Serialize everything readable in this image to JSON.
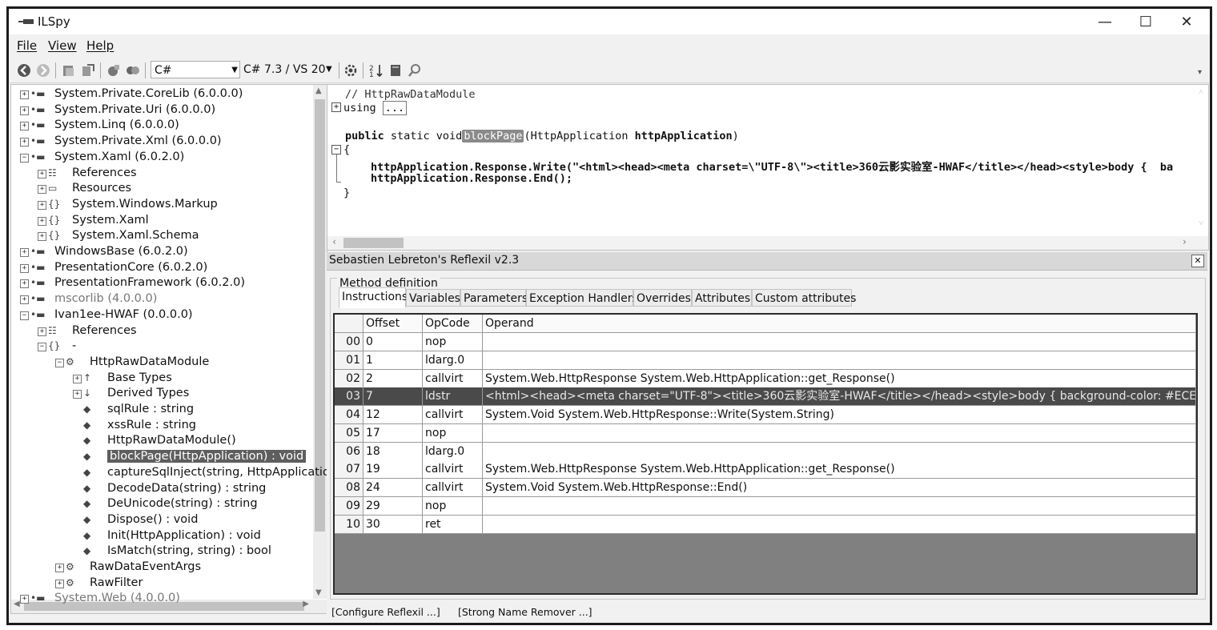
{
  "window": {
    "title": "ILSpy"
  },
  "menu": [
    "File",
    "View",
    "Help"
  ],
  "toolbar": {
    "language": "C#",
    "version": "C# 7.3 / VS 20"
  },
  "tree": {
    "nodes": [
      {
        "label": "System.Private.CoreLib (6.0.0.0)",
        "exp": "+"
      },
      {
        "label": "System.Private.Uri (6.0.0.0)",
        "exp": "+"
      },
      {
        "label": "System.Linq (6.0.0.0)",
        "exp": "+"
      },
      {
        "label": "System.Private.Xml (6.0.0.0)",
        "exp": "+"
      },
      {
        "label": "System.Xaml (6.0.2.0)",
        "exp": "-"
      },
      {
        "label": "References",
        "exp": "+"
      },
      {
        "label": "Resources",
        "exp": "+"
      },
      {
        "label": "System.Windows.Markup",
        "exp": "+"
      },
      {
        "label": "System.Xaml",
        "exp": "+"
      },
      {
        "label": "System.Xaml.Schema",
        "exp": "+"
      },
      {
        "label": "WindowsBase (6.0.2.0)",
        "exp": "+"
      },
      {
        "label": "PresentationCore (6.0.2.0)",
        "exp": "+"
      },
      {
        "label": "PresentationFramework (6.0.2.0)",
        "exp": "+"
      },
      {
        "label": "mscorlib (4.0.0.0)",
        "exp": "+"
      },
      {
        "label": "Ivan1ee-HWAF (0.0.0.0)",
        "exp": "-"
      },
      {
        "label": "References",
        "exp": "+"
      },
      {
        "label": "-",
        "exp": "-"
      },
      {
        "label": "HttpRawDataModule",
        "exp": "-"
      },
      {
        "label": "Base Types",
        "exp": "+"
      },
      {
        "label": "Derived Types",
        "exp": "+"
      },
      {
        "label": "sqlRule : string",
        "exp": ""
      },
      {
        "label": "xssRule : string",
        "exp": ""
      },
      {
        "label": "HttpRawDataModule()",
        "exp": ""
      },
      {
        "label": "blockPage(HttpApplication) : void",
        "exp": ""
      },
      {
        "label": "captureSqlInject(string, HttpApplicatio",
        "exp": ""
      },
      {
        "label": "DecodeData(string) : string",
        "exp": ""
      },
      {
        "label": "DeUnicode(string) : string",
        "exp": ""
      },
      {
        "label": "Dispose() : void",
        "exp": ""
      },
      {
        "label": "Init(HttpApplication) : void",
        "exp": ""
      },
      {
        "label": "IsMatch(string, string) : bool",
        "exp": ""
      },
      {
        "label": "RawDataEventArgs",
        "exp": "+"
      },
      {
        "label": "RawFilter",
        "exp": "+"
      },
      {
        "label": "System.Web (4.0.0.0)",
        "exp": "+"
      }
    ]
  },
  "code": {
    "comment": "// HttpRawDataModule",
    "using_kw": "using",
    "using_fold": "...",
    "sig_public": "public",
    "sig_static": " static void",
    "sig_name": "blockPage",
    "sig_params_open": "(HttpApplication ",
    "sig_param_name": "httpApplication",
    "sig_close": ")",
    "brace_open": "{",
    "line1": "httpApplication.Response.Write(\"<html><head><meta charset=\\\"UTF-8\\\"><title>360云影实验室-HWAF</title></head><style>body {  ba",
    "line2": "httpApplication.Response.End();",
    "brace_close": "}"
  },
  "reflexil": {
    "title": "Sebastien Lebreton's Reflexil v2.3",
    "group": "Method definition",
    "tabs": [
      "Instructions",
      "Variables",
      "Parameters",
      "Exception Handlers",
      "Overrides",
      "Attributes",
      "Custom attributes"
    ],
    "columns": [
      "Offset",
      "OpCode",
      "Operand"
    ],
    "rows": [
      {
        "idx": "00",
        "offset": "0",
        "opcode": "nop",
        "operand": ""
      },
      {
        "idx": "01",
        "offset": "1",
        "opcode": "ldarg.0",
        "operand": ""
      },
      {
        "idx": "02",
        "offset": "2",
        "opcode": "callvirt",
        "operand": "System.Web.HttpResponse System.Web.HttpApplication::get_Response()"
      },
      {
        "idx": "03",
        "offset": "7",
        "opcode": "ldstr",
        "operand": "<html><head><meta charset=\"UTF-8\"><title>360云影实验室-HWAF</title></head><style>body {  background-color: #ECECEC;  fo..."
      },
      {
        "idx": "04",
        "offset": "12",
        "opcode": "callvirt",
        "operand": "System.Void System.Web.HttpResponse::Write(System.String)"
      },
      {
        "idx": "05",
        "offset": "17",
        "opcode": "nop",
        "operand": ""
      },
      {
        "idx": "06",
        "offset": "18",
        "opcode": "ldarg.0",
        "operand": ""
      },
      {
        "idx": "07",
        "offset": "19",
        "opcode": "callvirt",
        "operand": "System.Web.HttpResponse System.Web.HttpApplication::get_Response()"
      },
      {
        "idx": "08",
        "offset": "24",
        "opcode": "callvirt",
        "operand": "System.Void System.Web.HttpResponse::End()"
      },
      {
        "idx": "09",
        "offset": "29",
        "opcode": "nop",
        "operand": ""
      },
      {
        "idx": "10",
        "offset": "30",
        "opcode": "ret",
        "operand": ""
      }
    ],
    "selected_row": "03",
    "footer": [
      "[Configure Reflexil ...]",
      "[Strong Name Remover ...]"
    ]
  }
}
